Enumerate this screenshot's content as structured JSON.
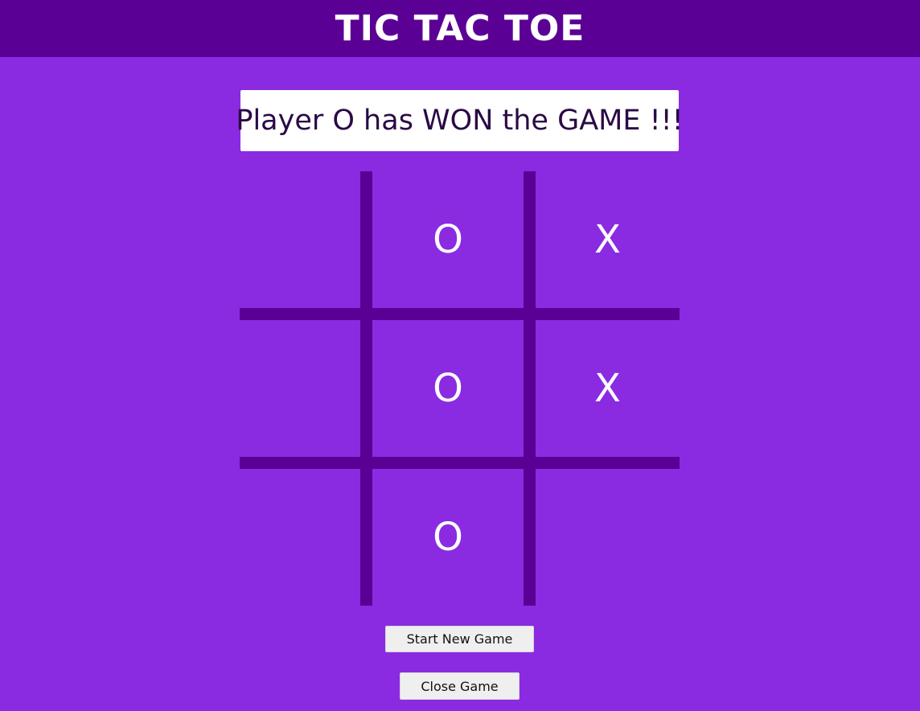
{
  "header": {
    "title": "TIC TAC TOE"
  },
  "status": {
    "message": "Player O has WON the GAME !!!"
  },
  "board": {
    "cells": [
      [
        "",
        "O",
        "X"
      ],
      [
        "",
        "O",
        "X"
      ],
      [
        "",
        "O",
        ""
      ]
    ]
  },
  "buttons": {
    "start_new_game": "Start New Game",
    "close_game": "Close Game"
  },
  "colors": {
    "background": "#8a2be2",
    "header": "#5b0094",
    "grid_lines": "#5b0094",
    "status_box": "#ffffff",
    "status_text": "#2a0a45",
    "mark": "#ffffff"
  }
}
